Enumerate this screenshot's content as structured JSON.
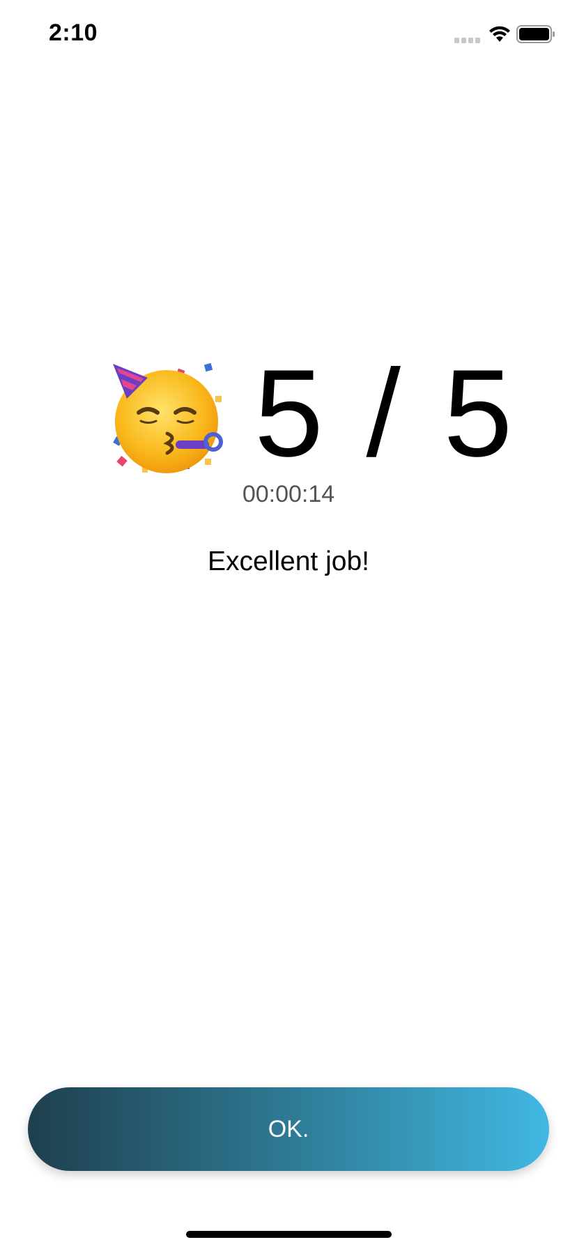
{
  "status_bar": {
    "time": "2:10",
    "icons": [
      "cellular-signal-icon",
      "wifi-icon",
      "battery-icon"
    ]
  },
  "result": {
    "icon": "partying-face-icon",
    "score": "5 / 5",
    "elapsed_time": "00:00:14",
    "message": "Excellent job!"
  },
  "actions": {
    "ok_label": "OK."
  },
  "colors": {
    "button_gradient_start": "#1f3f4e",
    "button_gradient_end": "#41b8e3"
  }
}
